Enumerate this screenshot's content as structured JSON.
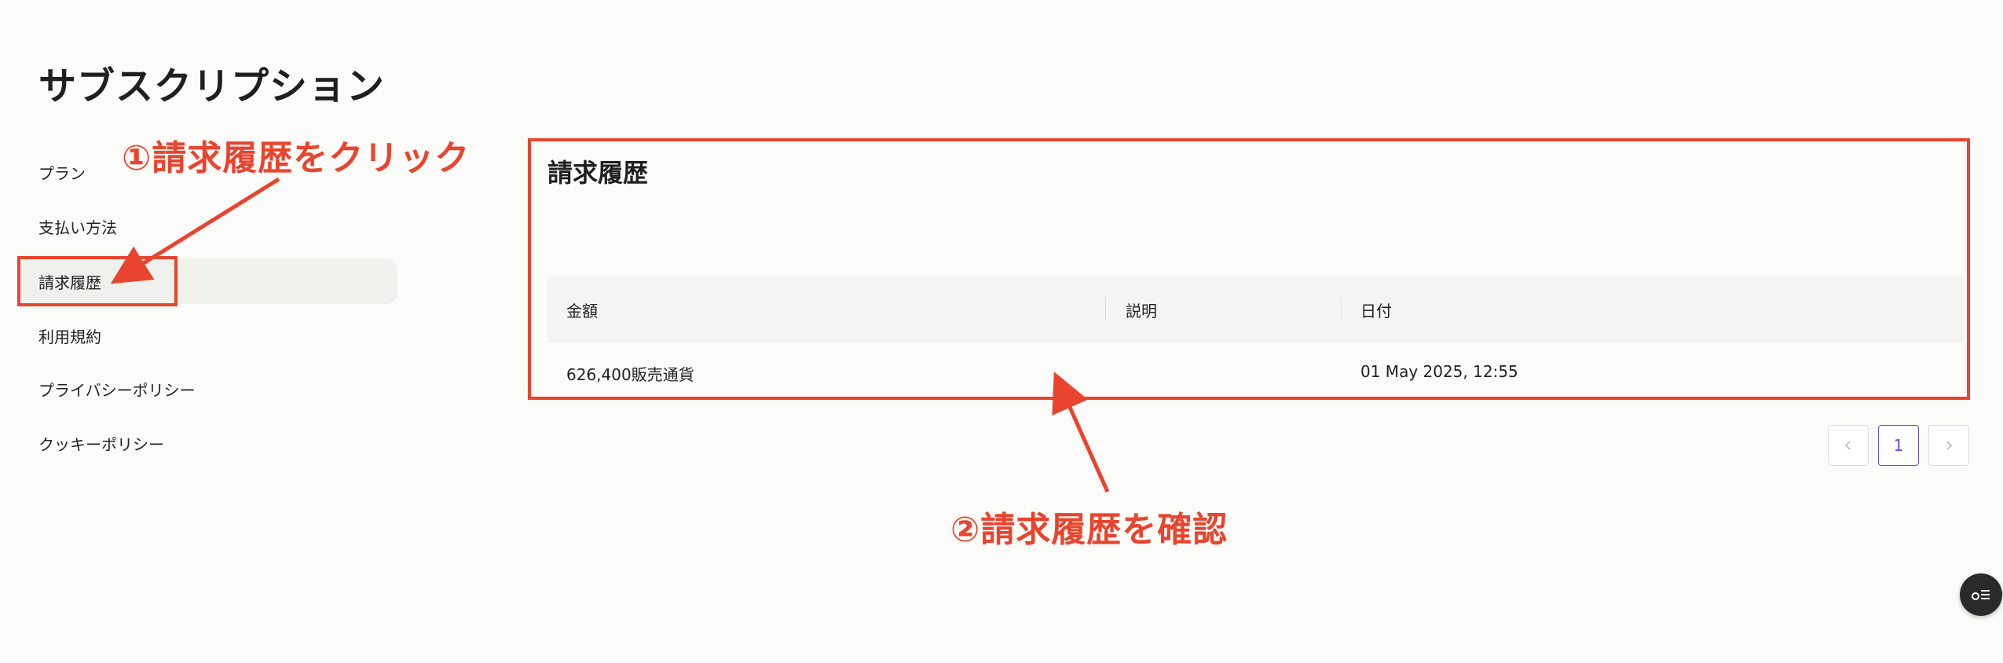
{
  "page": {
    "title": "サブスクリプション"
  },
  "sidebar": {
    "items": [
      {
        "label": "プラン"
      },
      {
        "label": "支払い方法"
      },
      {
        "label": "請求履歴"
      },
      {
        "label": "利用規約"
      },
      {
        "label": "プライバシーポリシー"
      },
      {
        "label": "クッキーポリシー"
      }
    ],
    "active_index": 2
  },
  "panel": {
    "title": "請求履歴"
  },
  "table": {
    "columns": [
      "金額",
      "説明",
      "日付"
    ],
    "rows": [
      {
        "amount": "626,400販売通貨",
        "description": "",
        "date": "01 May 2025, 12:55"
      }
    ]
  },
  "pagination": {
    "prev_icon": "chevron-left-icon",
    "current_page": "1",
    "next_icon": "chevron-right-icon"
  },
  "fab": {
    "icon": "settings-list-icon"
  },
  "annotations": {
    "step1": "①請求履歴をクリック",
    "step2": "②請求履歴を確認",
    "color": "#e8442e"
  },
  "colors": {
    "background": "#fbfbf9",
    "active_item_bg": "#f0f0ec",
    "table_header_bg": "#f4f4f2",
    "accent": "#6c4ad6"
  }
}
